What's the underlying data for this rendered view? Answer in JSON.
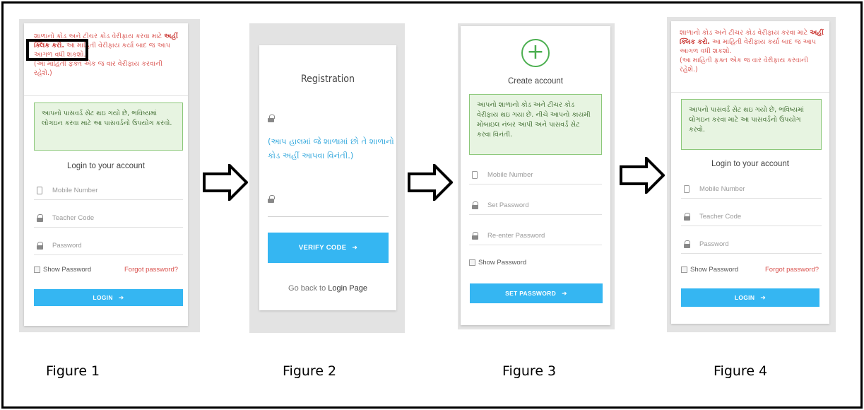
{
  "figure1": {
    "note_line1": "શાળાનો કોડ અને ટીચર કોડ વેરીફાય કરવા માટે",
    "note_link": "અહીં ક્લિક કરો.",
    "note_rest": " આ માહિતી વેરીફાય કર્યા બાદ જ આપ આગળ વધી શકશો.",
    "note_line3": "(આ માહિતી ફક્ત એક જ વાર વેરીફાય કરવાની રહેશે.)",
    "green_text": "આપનો પાસવર્ડ સેટ થઇ ગયો છે, ભવિષ્યમાં લોગઇન કરવા માટે આ પાસવર્ડનો ઉપયોગ કરવો.",
    "heading": "Login to your account",
    "fields": [
      "Mobile Number",
      "Teacher Code",
      "Password"
    ],
    "show_password": "Show Password",
    "forgot_password": "Forgot password?",
    "login_button": "LOGIN"
  },
  "figure2": {
    "title": "Registration",
    "blue_note": "(આપ હાલમાં જે શાળામાં છો તે શાળાનો કોડ અહીં આપવા વિનંતી.)",
    "verify_button": "VERIFY CODE",
    "back_text": "Go back to ",
    "back_link": "Login Page"
  },
  "figure3": {
    "plus": "+",
    "heading": "Create account",
    "green_text": "આપનો શાળાનો કોડ અને ટીચર કોડ વેરીફાય થઇ ગયા છે. નીચે આપનો કાયમી મોબાઇલ નંબર આપી અને પાસવર્ડ સેટ કરવા વિનંતી.",
    "fields": [
      "Mobile Number",
      "Set Password",
      "Re-enter Password"
    ],
    "show_password": "Show Password",
    "set_button": "SET PASSWORD"
  },
  "figure4": {
    "note_line1": "શાળાનો કોડ અને ટીચર કોડ વેરીફાય કરવા માટે",
    "note_link": "અહીં ક્લિક કરો.",
    "note_rest": " આ માહિતી વેરીફાય કર્યા બાદ જ આપ આગળ વધી શકશો.",
    "note_line3": "(આ માહિતી ફક્ત એક જ વાર વેરીફાય કરવાની રહેશે.)",
    "green_text": "આપનો પાસવર્ડ સેટ થઇ ગયો છે, ભવિષ્યમાં લોગઇન કરવા માટે આ પાસવર્ડનો ઉપયોગ કરવો.",
    "heading": "Login to your account",
    "fields": [
      "Mobile Number",
      "Teacher Code",
      "Password"
    ],
    "show_password": "Show Password",
    "forgot_password": "Forgot password?",
    "login_button": "LOGIN"
  },
  "labels": [
    "Figure 1",
    "Figure 2",
    "Figure 3",
    "Figure 4"
  ],
  "colors": {
    "accent_blue": "#35b6f2",
    "error_red": "#d9534f",
    "success_green": "#4caf50"
  }
}
